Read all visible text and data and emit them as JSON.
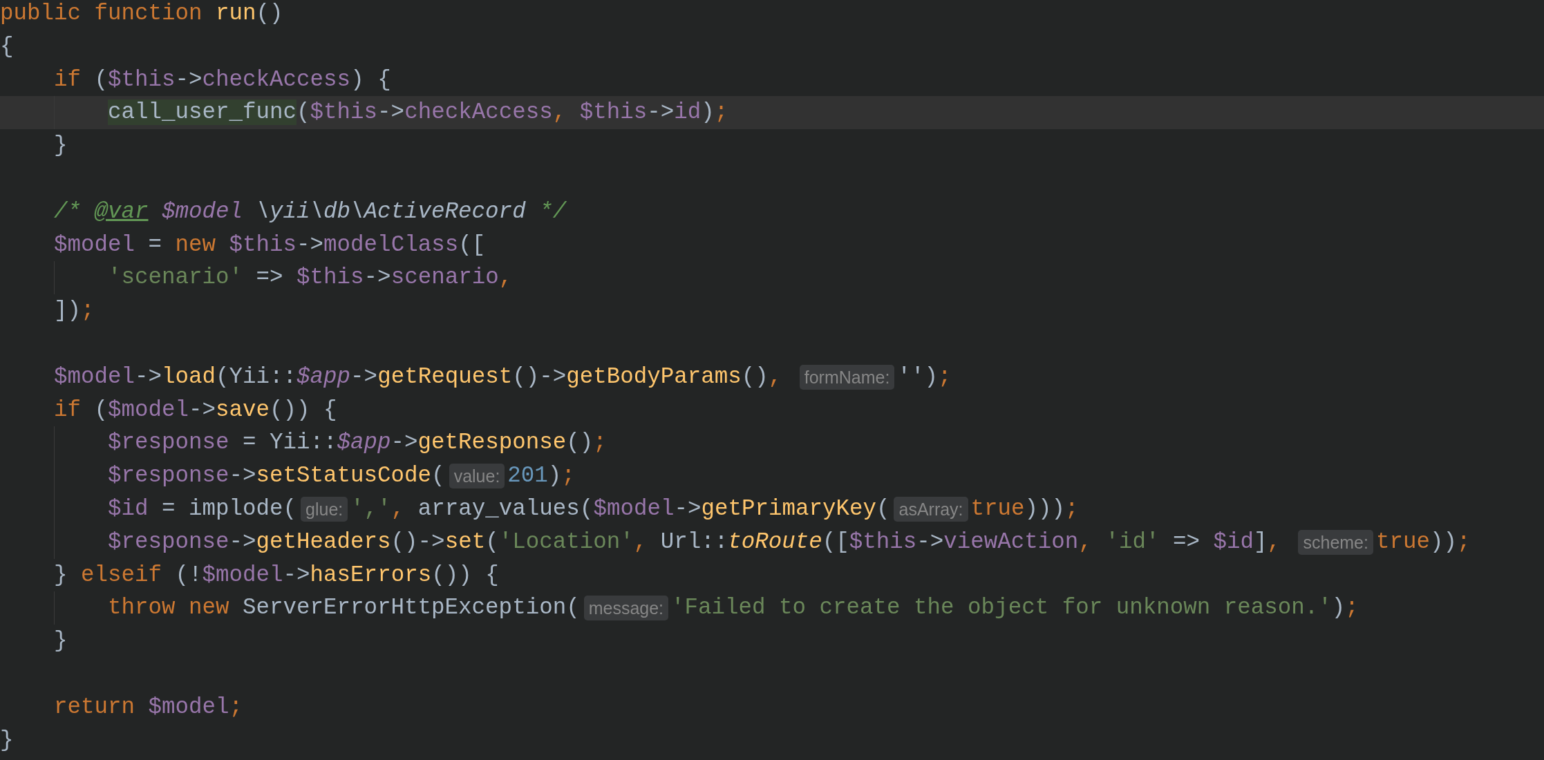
{
  "editor": {
    "lines": [
      {
        "kind": "code",
        "tokens": [
          {
            "kind": "k",
            "text": "public function "
          },
          {
            "kind": "f",
            "text": "run"
          },
          {
            "kind": "p",
            "text": "()"
          }
        ]
      },
      {
        "kind": "code",
        "tokens": [
          {
            "kind": "p",
            "text": "{"
          }
        ],
        "children": [
          {
            "kind": "code",
            "tokens": [
              {
                "kind": "k",
                "text": "if "
              },
              {
                "kind": "p",
                "text": "("
              },
              {
                "kind": "v",
                "text": "$this"
              },
              {
                "kind": "p",
                "text": "->"
              },
              {
                "kind": "v",
                "text": "checkAccess"
              },
              {
                "kind": "p",
                "text": ") {"
              }
            ],
            "children": [
              {
                "kind": "code",
                "current": true,
                "tokens": [
                  {
                    "kind": "hl",
                    "text": "call_user_func"
                  },
                  {
                    "kind": "p",
                    "text": "("
                  },
                  {
                    "kind": "v",
                    "text": "$this"
                  },
                  {
                    "kind": "p",
                    "text": "->"
                  },
                  {
                    "kind": "v",
                    "text": "checkAccess"
                  },
                  {
                    "kind": "k",
                    "text": ", "
                  },
                  {
                    "kind": "v",
                    "text": "$this"
                  },
                  {
                    "kind": "p",
                    "text": "->"
                  },
                  {
                    "kind": "v",
                    "text": "id"
                  },
                  {
                    "kind": "p",
                    "text": ")"
                  },
                  {
                    "kind": "k",
                    "text": ";"
                  }
                ]
              }
            ]
          },
          {
            "kind": "code",
            "tokens": [
              {
                "kind": "p",
                "text": "}"
              }
            ]
          },
          {
            "kind": "blank"
          },
          {
            "kind": "code",
            "tokens": [
              {
                "kind": "c",
                "text": "/* "
              },
              {
                "kind": "ct",
                "text": "@var"
              },
              {
                "kind": "vi",
                "text": " $model"
              },
              {
                "kind": "pi",
                "text": " \\yii\\db\\ActiveRecord"
              },
              {
                "kind": "c",
                "text": " */"
              }
            ]
          },
          {
            "kind": "code",
            "tokens": [
              {
                "kind": "v",
                "text": "$model"
              },
              {
                "kind": "p",
                "text": " = "
              },
              {
                "kind": "k",
                "text": "new "
              },
              {
                "kind": "v",
                "text": "$this"
              },
              {
                "kind": "p",
                "text": "->"
              },
              {
                "kind": "v",
                "text": "modelClass"
              },
              {
                "kind": "p",
                "text": "(["
              }
            ],
            "children": [
              {
                "kind": "code",
                "tokens": [
                  {
                    "kind": "s",
                    "text": "'scenario'"
                  },
                  {
                    "kind": "p",
                    "text": " => "
                  },
                  {
                    "kind": "v",
                    "text": "$this"
                  },
                  {
                    "kind": "p",
                    "text": "->"
                  },
                  {
                    "kind": "v",
                    "text": "scenario"
                  },
                  {
                    "kind": "k",
                    "text": ","
                  }
                ]
              }
            ]
          },
          {
            "kind": "code",
            "tokens": [
              {
                "kind": "p",
                "text": "])"
              },
              {
                "kind": "k",
                "text": ";"
              }
            ]
          },
          {
            "kind": "blank"
          },
          {
            "kind": "code",
            "tokens": [
              {
                "kind": "v",
                "text": "$model"
              },
              {
                "kind": "p",
                "text": "->"
              },
              {
                "kind": "f",
                "text": "load"
              },
              {
                "kind": "p",
                "text": "(Yii::"
              },
              {
                "kind": "vi",
                "text": "$app"
              },
              {
                "kind": "p",
                "text": "->"
              },
              {
                "kind": "f",
                "text": "getRequest"
              },
              {
                "kind": "p",
                "text": "()->"
              },
              {
                "kind": "f",
                "text": "getBodyParams"
              },
              {
                "kind": "p",
                "text": "()"
              },
              {
                "kind": "k",
                "text": ", "
              },
              {
                "kind": "h",
                "text": "formName:"
              },
              {
                "kind": "p",
                "text": "''"
              },
              {
                "kind": "p",
                "text": ")"
              },
              {
                "kind": "k",
                "text": ";"
              }
            ]
          },
          {
            "kind": "code",
            "tokens": [
              {
                "kind": "k",
                "text": "if "
              },
              {
                "kind": "p",
                "text": "("
              },
              {
                "kind": "v",
                "text": "$model"
              },
              {
                "kind": "p",
                "text": "->"
              },
              {
                "kind": "f",
                "text": "save"
              },
              {
                "kind": "p",
                "text": "()) {"
              }
            ],
            "children": [
              {
                "kind": "code",
                "tokens": [
                  {
                    "kind": "v",
                    "text": "$response"
                  },
                  {
                    "kind": "p",
                    "text": " = Yii::"
                  },
                  {
                    "kind": "vi",
                    "text": "$app"
                  },
                  {
                    "kind": "p",
                    "text": "->"
                  },
                  {
                    "kind": "f",
                    "text": "getResponse"
                  },
                  {
                    "kind": "p",
                    "text": "()"
                  },
                  {
                    "kind": "k",
                    "text": ";"
                  }
                ]
              },
              {
                "kind": "code",
                "tokens": [
                  {
                    "kind": "v",
                    "text": "$response"
                  },
                  {
                    "kind": "p",
                    "text": "->"
                  },
                  {
                    "kind": "f",
                    "text": "setStatusCode"
                  },
                  {
                    "kind": "p",
                    "text": "("
                  },
                  {
                    "kind": "h",
                    "text": "value:"
                  },
                  {
                    "kind": "n",
                    "text": "201"
                  },
                  {
                    "kind": "p",
                    "text": ")"
                  },
                  {
                    "kind": "k",
                    "text": ";"
                  }
                ]
              },
              {
                "kind": "code",
                "tokens": [
                  {
                    "kind": "v",
                    "text": "$id"
                  },
                  {
                    "kind": "p",
                    "text": " = implode("
                  },
                  {
                    "kind": "h",
                    "text": "glue:"
                  },
                  {
                    "kind": "s",
                    "text": "','"
                  },
                  {
                    "kind": "k",
                    "text": ", "
                  },
                  {
                    "kind": "p",
                    "text": "array_values("
                  },
                  {
                    "kind": "v",
                    "text": "$model"
                  },
                  {
                    "kind": "p",
                    "text": "->"
                  },
                  {
                    "kind": "f",
                    "text": "getPrimaryKey"
                  },
                  {
                    "kind": "p",
                    "text": "("
                  },
                  {
                    "kind": "h",
                    "text": "asArray:"
                  },
                  {
                    "kind": "k",
                    "text": "true"
                  },
                  {
                    "kind": "p",
                    "text": ")))"
                  },
                  {
                    "kind": "k",
                    "text": ";"
                  }
                ]
              },
              {
                "kind": "code",
                "tokens": [
                  {
                    "kind": "v",
                    "text": "$response"
                  },
                  {
                    "kind": "p",
                    "text": "->"
                  },
                  {
                    "kind": "f",
                    "text": "getHeaders"
                  },
                  {
                    "kind": "p",
                    "text": "()->"
                  },
                  {
                    "kind": "f",
                    "text": "set"
                  },
                  {
                    "kind": "p",
                    "text": "("
                  },
                  {
                    "kind": "s",
                    "text": "'Location'"
                  },
                  {
                    "kind": "k",
                    "text": ", "
                  },
                  {
                    "kind": "p",
                    "text": "Url::"
                  },
                  {
                    "kind": "fi",
                    "text": "toRoute"
                  },
                  {
                    "kind": "p",
                    "text": "(["
                  },
                  {
                    "kind": "v",
                    "text": "$this"
                  },
                  {
                    "kind": "p",
                    "text": "->"
                  },
                  {
                    "kind": "v",
                    "text": "viewAction"
                  },
                  {
                    "kind": "k",
                    "text": ", "
                  },
                  {
                    "kind": "s",
                    "text": "'id'"
                  },
                  {
                    "kind": "p",
                    "text": " => "
                  },
                  {
                    "kind": "v",
                    "text": "$id"
                  },
                  {
                    "kind": "p",
                    "text": "]"
                  },
                  {
                    "kind": "k",
                    "text": ", "
                  },
                  {
                    "kind": "h",
                    "text": "scheme:"
                  },
                  {
                    "kind": "k",
                    "text": "true"
                  },
                  {
                    "kind": "p",
                    "text": "))"
                  },
                  {
                    "kind": "k",
                    "text": ";"
                  }
                ]
              }
            ]
          },
          {
            "kind": "code",
            "tokens": [
              {
                "kind": "p",
                "text": "} "
              },
              {
                "kind": "k",
                "text": "elseif "
              },
              {
                "kind": "p",
                "text": "(!"
              },
              {
                "kind": "v",
                "text": "$model"
              },
              {
                "kind": "p",
                "text": "->"
              },
              {
                "kind": "f",
                "text": "hasErrors"
              },
              {
                "kind": "p",
                "text": "()) {"
              }
            ],
            "children": [
              {
                "kind": "code",
                "tokens": [
                  {
                    "kind": "k",
                    "text": "throw new "
                  },
                  {
                    "kind": "p",
                    "text": "ServerErrorHttpException("
                  },
                  {
                    "kind": "h",
                    "text": "message:"
                  },
                  {
                    "kind": "s",
                    "text": "'Failed to create the object for unknown reason.'"
                  },
                  {
                    "kind": "p",
                    "text": ")"
                  },
                  {
                    "kind": "k",
                    "text": ";"
                  }
                ]
              }
            ]
          },
          {
            "kind": "code",
            "tokens": [
              {
                "kind": "p",
                "text": "}"
              }
            ]
          },
          {
            "kind": "blank"
          },
          {
            "kind": "code",
            "tokens": [
              {
                "kind": "k",
                "text": "return "
              },
              {
                "kind": "v",
                "text": "$model"
              },
              {
                "kind": "k",
                "text": ";"
              }
            ]
          }
        ]
      },
      {
        "kind": "code",
        "tokens": [
          {
            "kind": "p",
            "text": "}"
          }
        ]
      }
    ]
  }
}
